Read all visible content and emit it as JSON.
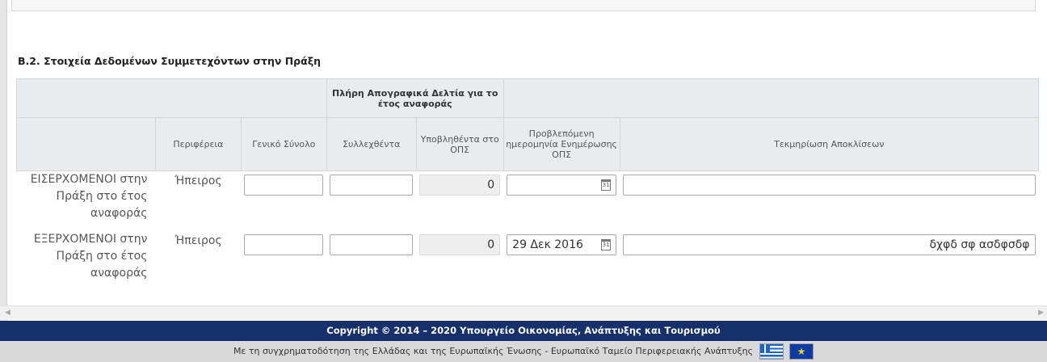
{
  "section": {
    "title": "B.2. Στοιχεία Δεδομένων Συμμετεχόντων στην Πράξη"
  },
  "table": {
    "group_header": "Πλήρη Απογραφικά Δελτία για το έτος αναφοράς",
    "columns": {
      "region": "Περιφέρεια",
      "total": "Γενικό Σύνολο",
      "collected": "Συλλεχθέντα",
      "submitted": "Υποβληθέντα στο ΟΠΣ",
      "planned_date": "Προβλεπόμενη ημερομηνία Ενημέρωσης ΟΠΣ",
      "justification": "Τεκμηρίωση Αποκλίσεων"
    },
    "rows": [
      {
        "label": "ΕΙΣΕΡΧΟΜΕΝΟΙ στην Πράξη στο έτος αναφοράς",
        "region": "Ήπειρος",
        "total": "",
        "collected": "",
        "submitted": "0",
        "planned_date": "",
        "justification": ""
      },
      {
        "label": "ΕΞΕΡΧΟΜΕΝΟΙ στην Πράξη στο έτος αναφοράς",
        "region": "Ήπειρος",
        "total": "",
        "collected": "",
        "submitted": "0",
        "planned_date": "29 Δεκ 2016",
        "justification": "δχφδ σφ ασδφσδφ"
      }
    ]
  },
  "icons": {
    "calendar": "calendar-icon",
    "scroll_left": "scroll-left-arrow",
    "scroll_right": "scroll-right-arrow"
  },
  "footer": {
    "copyright": "Copyright © 2014 – 2020 Υπουργείο Οικονομίας, Ανάπτυξης και Τουρισμού",
    "funding": "Με τη συγχρηματοδότηση της Ελλάδας και της Ευρωπαϊκής Ένωσης - Ευρωπαϊκό Ταμείο Περιφερειακής Ανάπτυξης"
  },
  "colors": {
    "footer_bg": "#15306b",
    "header_bg": "#e9ecef"
  }
}
